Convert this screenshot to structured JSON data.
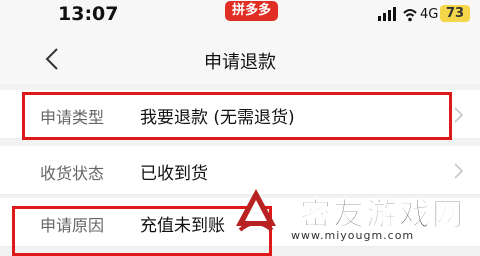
{
  "status_bar": {
    "time": "13:07",
    "app_badge": "拼多多",
    "network": "4G",
    "battery": "73"
  },
  "nav": {
    "title": "申请退款"
  },
  "rows": [
    {
      "label": "申请类型",
      "value": "我要退款 (无需退货)"
    },
    {
      "label": "收货状态",
      "value": "已收到货"
    },
    {
      "label": "申请原因",
      "value": "充值未到账"
    }
  ],
  "watermark": {
    "site_name": "密友游戏网",
    "url": "www.miyougm.com"
  },
  "colors": {
    "highlight": "#e01818",
    "brand": "#e02e24",
    "battery": "#f5d64a"
  }
}
